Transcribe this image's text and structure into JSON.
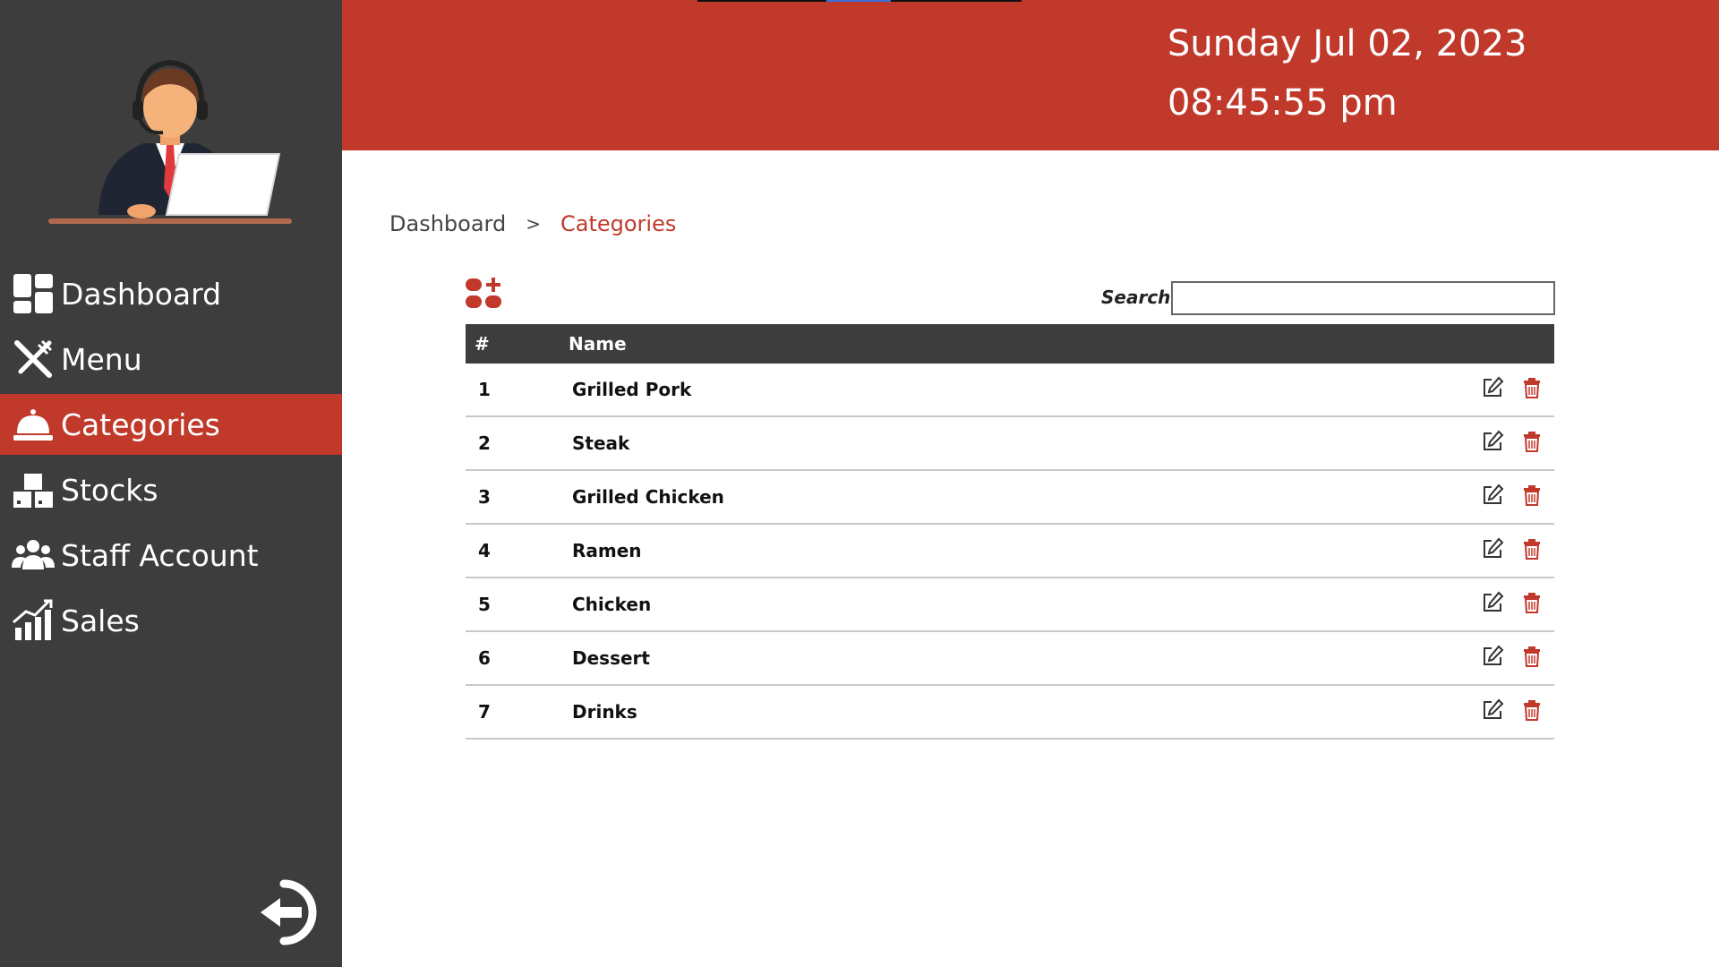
{
  "header": {
    "date": "Sunday Jul 02, 2023",
    "time": "08:45:55 pm"
  },
  "sidebar": {
    "items": [
      {
        "label": "Dashboard",
        "icon": "dashboard-icon",
        "active": false
      },
      {
        "label": "Menu",
        "icon": "utensils-icon",
        "active": false
      },
      {
        "label": "Categories",
        "icon": "service-bell-icon",
        "active": true
      },
      {
        "label": "Stocks",
        "icon": "boxes-icon",
        "active": false
      },
      {
        "label": "Staff Account",
        "icon": "users-icon",
        "active": false
      },
      {
        "label": "Sales",
        "icon": "chart-icon",
        "active": false
      }
    ],
    "logout_icon": "logout-icon"
  },
  "breadcrumb": {
    "home": "Dashboard",
    "separator": ">",
    "current": "Categories"
  },
  "toolbar": {
    "search_label": "Search:",
    "search_value": "",
    "add_icon": "add-category-icon"
  },
  "table": {
    "headers": [
      "#",
      "Name"
    ],
    "rows": [
      {
        "num": "1",
        "name": "Grilled Pork"
      },
      {
        "num": "2",
        "name": "Steak"
      },
      {
        "num": "3",
        "name": "Grilled Chicken"
      },
      {
        "num": "4",
        "name": "Ramen"
      },
      {
        "num": "5",
        "name": "Chicken"
      },
      {
        "num": "6",
        "name": "Dessert"
      },
      {
        "num": "7",
        "name": "Drinks"
      }
    ]
  },
  "colors": {
    "accent": "#c0392b",
    "sidebar": "#3d3d3d",
    "table_header": "#3d3d3d"
  }
}
